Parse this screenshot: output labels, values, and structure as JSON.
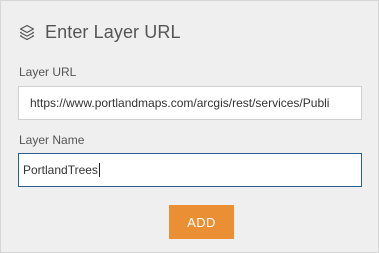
{
  "panel": {
    "title": "Enter Layer URL",
    "title_icon": "layers-icon"
  },
  "layer_url": {
    "label": "Layer URL",
    "value": "https://www.portlandmaps.com/arcgis/rest/services/Publi"
  },
  "layer_name": {
    "label": "Layer Name",
    "value": "PortlandTrees"
  },
  "add_button": {
    "label": "ADD",
    "color": "#eb8f35"
  }
}
